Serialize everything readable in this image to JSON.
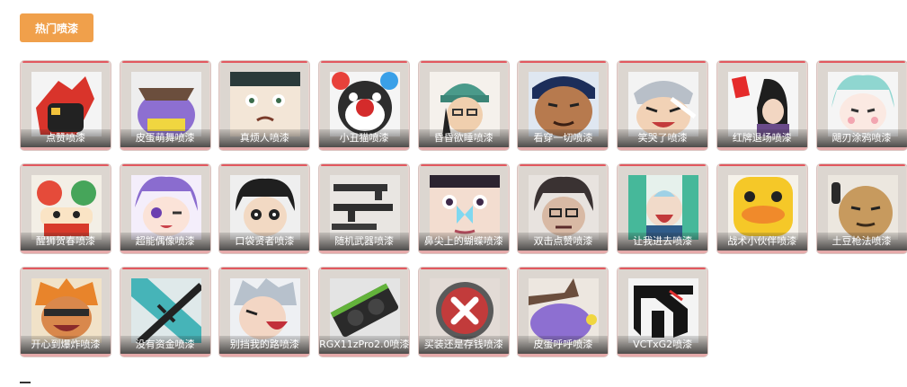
{
  "tab": {
    "label": "热门喷漆"
  },
  "colors": {
    "tab_bg": "#f0a04b",
    "card_bg": "#dcd6d0",
    "card_accent": "#e2585f"
  },
  "sprays": [
    {
      "label": "点赞喷漆",
      "icon": "thumbs-up-glove-icon"
    },
    {
      "label": "皮蛋萌舞喷漆",
      "icon": "purple-critter-hat-icon"
    },
    {
      "label": "真烦人喷漆",
      "icon": "annoyed-face-icon"
    },
    {
      "label": "小丑猫喷漆",
      "icon": "clown-cat-icon"
    },
    {
      "label": "昏昏欲睡喷漆",
      "icon": "sleepy-beanie-girl-icon"
    },
    {
      "label": "看穿一切喷漆",
      "icon": "knowing-face-icon"
    },
    {
      "label": "笑哭了喷漆",
      "icon": "laughing-tears-icon"
    },
    {
      "label": "红牌退场喷漆",
      "icon": "red-card-icon"
    },
    {
      "label": "飓刃涂鸦喷漆",
      "icon": "teal-hair-doodle-icon"
    },
    {
      "label": "醒狮贺春喷漆",
      "icon": "lion-dance-icon"
    },
    {
      "label": "超能偶像喷漆",
      "icon": "idol-wink-icon"
    },
    {
      "label": "口袋贤者喷漆",
      "icon": "pocket-sage-icon"
    },
    {
      "label": "随机武器喷漆",
      "icon": "random-weapons-icon"
    },
    {
      "label": "鼻尖上的蝴蝶喷漆",
      "icon": "butterfly-nose-icon"
    },
    {
      "label": "双击点赞喷漆",
      "icon": "double-tap-icon"
    },
    {
      "label": "让我进去喷漆",
      "icon": "let-me-in-icon"
    },
    {
      "label": "战术小伙伴喷漆",
      "icon": "duck-icon"
    },
    {
      "label": "土豆枪法喷漆",
      "icon": "potato-icon"
    },
    {
      "label": "开心到爆炸喷漆",
      "icon": "happy-explode-icon"
    },
    {
      "label": "没有资金喷漆",
      "icon": "no-funds-icon"
    },
    {
      "label": "别挡我的路喷漆",
      "icon": "shouting-icon"
    },
    {
      "label": "RGX11zPro2.0喷漆",
      "icon": "rgx-gpu-icon"
    },
    {
      "label": "买装还是存钱喷漆",
      "icon": "red-x-icon"
    },
    {
      "label": "皮蛋呼呼喷漆",
      "icon": "sleeping-critter-icon"
    },
    {
      "label": "VCTxG2喷漆",
      "icon": "g2-logo-icon"
    }
  ]
}
